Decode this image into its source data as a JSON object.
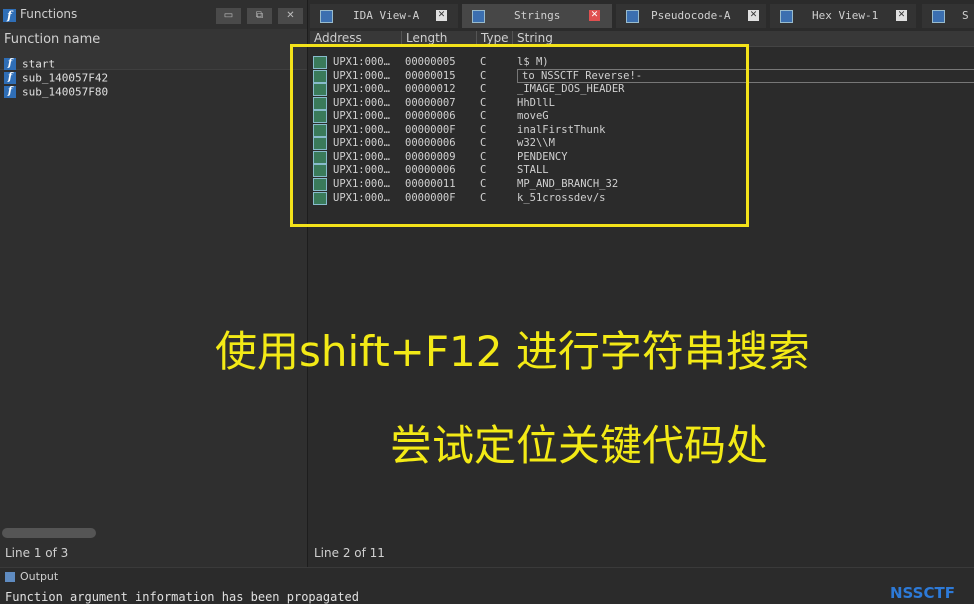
{
  "functions_panel": {
    "title": "Functions",
    "column_header": "Function name",
    "items": [
      "start",
      "sub_140057F42",
      "sub_140057F80"
    ],
    "status": "Line 1 of 3"
  },
  "tabs": [
    {
      "label": "IDA View-A",
      "active": false
    },
    {
      "label": "Strings",
      "active": true
    },
    {
      "label": "Pseudocode-A",
      "active": false
    },
    {
      "label": "Hex View-1",
      "active": false
    },
    {
      "label": "S",
      "active": false
    }
  ],
  "strings_panel": {
    "columns": [
      "Address",
      "Length",
      "Type",
      "String"
    ],
    "rows": [
      {
        "address": "UPX1:000…",
        "length": "00000005",
        "type": "C",
        "string": "l$ M)"
      },
      {
        "address": "UPX1:000…",
        "length": "00000015",
        "type": "C",
        "string": " to NSSCTF Reverse!-"
      },
      {
        "address": "UPX1:000…",
        "length": "00000012",
        "type": "C",
        "string": "_IMAGE_DOS_HEADER"
      },
      {
        "address": "UPX1:000…",
        "length": "00000007",
        "type": "C",
        "string": "HhDllL"
      },
      {
        "address": "UPX1:000…",
        "length": "00000006",
        "type": "C",
        "string": "moveG"
      },
      {
        "address": "UPX1:000…",
        "length": "0000000F",
        "type": "C",
        "string": "inalFirstThunk"
      },
      {
        "address": "UPX1:000…",
        "length": "00000006",
        "type": "C",
        "string": "w32\\\\M"
      },
      {
        "address": "UPX1:000…",
        "length": "00000009",
        "type": "C",
        "string": "PENDENCY"
      },
      {
        "address": "UPX1:000…",
        "length": "00000006",
        "type": "C",
        "string": "STALL"
      },
      {
        "address": "UPX1:000…",
        "length": "00000011",
        "type": "C",
        "string": "MP_AND_BRANCH_32"
      },
      {
        "address": "UPX1:000…",
        "length": "0000000F",
        "type": "C",
        "string": "k_51crossdev/s"
      }
    ],
    "status": "Line 2 of 11"
  },
  "captions": {
    "line1": "使用shift+F12 进行字符串搜索",
    "line2": "尝试定位关键代码处"
  },
  "output": {
    "label": "Output",
    "line": "Function argument information has been propagated"
  },
  "watermark": "NSSCTF",
  "colors": {
    "highlight": "#f3e21a",
    "caption": "#f3ea16",
    "brand": "#2d7ad8"
  }
}
